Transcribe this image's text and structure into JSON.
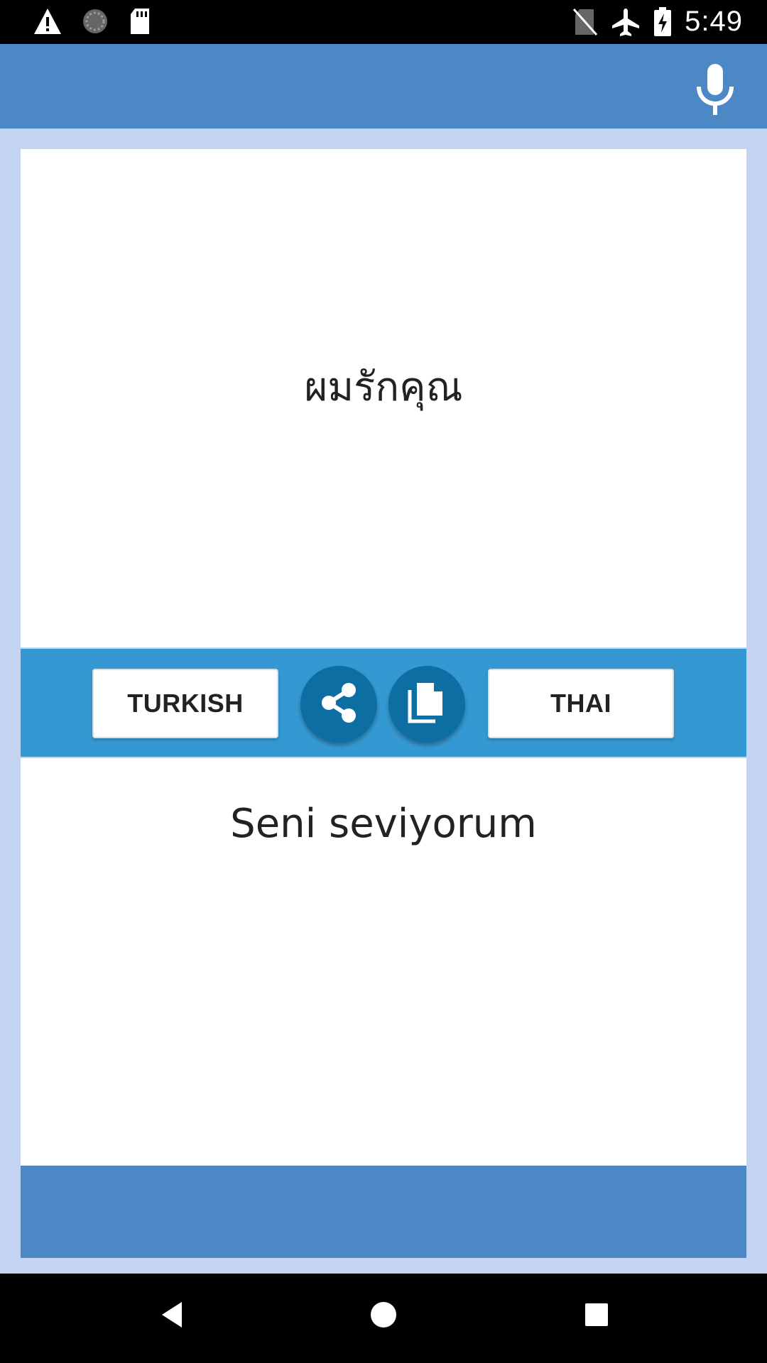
{
  "status_bar": {
    "time": "5:49",
    "left_icons": [
      "warning-icon",
      "sync-icon",
      "sd-card-icon"
    ],
    "right_icons": [
      "no-sim-icon",
      "airplane-icon",
      "battery-charging-icon"
    ]
  },
  "app_bar": {
    "mic_icon": "microphone-icon",
    "color": "#4c87c6"
  },
  "source": {
    "text": "ผมรักคุณ"
  },
  "toolbar": {
    "left_language": "TURKISH",
    "right_language": "THAI",
    "share_icon": "share-icon",
    "copy_icon": "copy-icon",
    "color": "#3499d2"
  },
  "target": {
    "text": "Seni seviyorum"
  },
  "nav_bar": {
    "icons": [
      "back-icon",
      "home-icon",
      "recents-icon"
    ]
  }
}
